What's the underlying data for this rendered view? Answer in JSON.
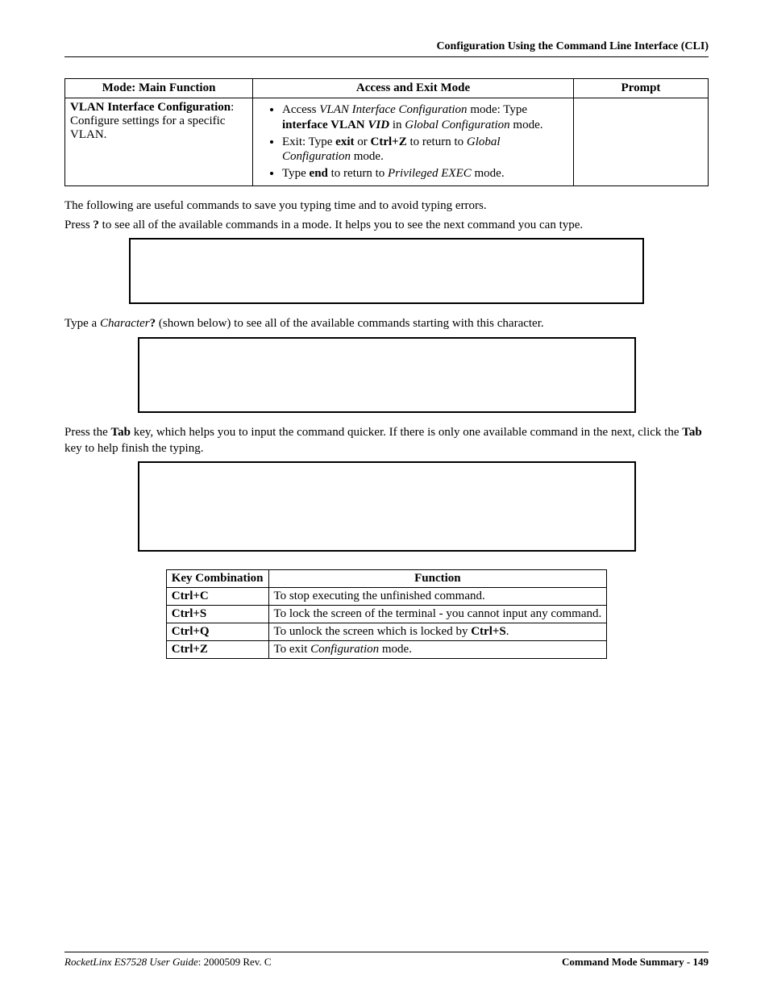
{
  "header": {
    "running": "Configuration Using the Command Line Interface (CLI)"
  },
  "modes_table": {
    "headers": [
      "Mode: Main Function",
      "Access and Exit Mode",
      "Prompt"
    ],
    "row": {
      "mode_title": "VLAN Interface Configuration",
      "mode_desc": ": Configure settings for a specific VLAN.",
      "access_items": [
        {
          "pre": "Access ",
          "ital1": "VLAN Interface Configuration",
          "mid1": " mode: Type ",
          "bold1": "interface VLAN ",
          "boldital": "VID",
          "mid2": " in ",
          "ital2": "Global Configuration",
          "post": " mode."
        },
        {
          "pre": "Exit: Type ",
          "bold1": "exit",
          "mid1": " or ",
          "bold2": "Ctrl+Z",
          "mid2": " to return to ",
          "ital1": "Global Configuration",
          "post": " mode."
        },
        {
          "pre": "Type ",
          "bold1": "end",
          "mid1": " to return to ",
          "ital1": "Privileged EXEC",
          "post": " mode."
        }
      ],
      "prompt": ""
    }
  },
  "paragraphs": {
    "p1": "The following are useful commands to save you typing time and to avoid typing errors.",
    "p2_pre": "Press ",
    "p2_bold": "?",
    "p2_post": " to see all of the available commands in a mode. It helps you to see the next command you can type.",
    "p3_pre": "Type a ",
    "p3_ital": "Character",
    "p3_bold": "?",
    "p3_post": " (shown below) to see all of the available commands starting with this character.",
    "p4_pre": "Press the ",
    "p4_b1": "Tab",
    "p4_mid": " key, which helps you to input the command quicker. If there is only one available command in the next, click the ",
    "p4_b2": "Tab",
    "p4_post": " key to help finish the typing."
  },
  "keys_table": {
    "headers": [
      "Key Combination",
      "Function"
    ],
    "rows": [
      {
        "k": "Ctrl+C",
        "f": "To stop executing the unfinished command."
      },
      {
        "k": "Ctrl+S",
        "f": "To lock the screen of the terminal - you cannot input any command."
      },
      {
        "k": "Ctrl+Q",
        "f_pre": "To unlock the screen which is locked by ",
        "f_bold": "Ctrl+S",
        "f_post": "."
      },
      {
        "k": "Ctrl+Z",
        "f_pre": "To exit ",
        "f_ital": "Configuration",
        "f_post": " mode."
      }
    ]
  },
  "footer": {
    "left_ital": "RocketLinx ES7528  User Guide",
    "left_rev": ": 2000509 Rev. C",
    "right": "Command Mode Summary - 149"
  }
}
